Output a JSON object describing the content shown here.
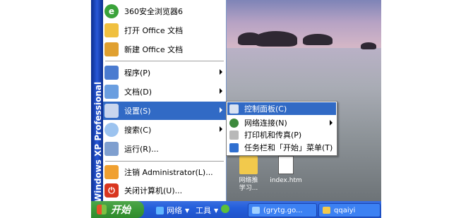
{
  "start_menu": {
    "sidebar_text": "Windows XP Professional",
    "pinned": [
      {
        "label": "360安全浏览器6",
        "icon": "browser-360-icon"
      },
      {
        "label": "打开 Office 文档",
        "icon": "open-office-doc-icon"
      },
      {
        "label": "新建 Office 文档",
        "icon": "new-office-doc-icon"
      }
    ],
    "items": [
      {
        "label": "程序(P)",
        "icon": "programs-icon",
        "has_submenu": true
      },
      {
        "label": "文档(D)",
        "icon": "documents-icon",
        "has_submenu": true
      },
      {
        "label": "设置(S)",
        "icon": "settings-icon",
        "has_submenu": true,
        "highlighted": true
      },
      {
        "label": "搜索(C)",
        "icon": "search-icon",
        "has_submenu": true
      },
      {
        "label": "运行(R)...",
        "icon": "run-icon",
        "has_submenu": false
      }
    ],
    "bottom": [
      {
        "label": "注销 Administrator(L)...",
        "icon": "logoff-icon"
      },
      {
        "label": "关闭计算机(U)...",
        "icon": "shutdown-icon"
      }
    ]
  },
  "settings_submenu": {
    "items": [
      {
        "label": "控制面板(C)",
        "icon": "control-panel-icon",
        "highlighted": true
      },
      {
        "label": "网络连接(N)",
        "icon": "network-connections-icon",
        "has_submenu": true
      },
      {
        "label": "打印机和传真(P)",
        "icon": "printers-faxes-icon"
      },
      {
        "label": "任务栏和「开始」菜单(T)",
        "icon": "taskbar-start-menu-icon"
      }
    ]
  },
  "desktop": {
    "icons": [
      {
        "label": "网络推\n学习...",
        "icon": "folder-icon"
      },
      {
        "label": "index.htm",
        "icon": "html-file-icon"
      }
    ]
  },
  "taskbar": {
    "start_label": "开始",
    "toolbar": [
      {
        "label": "网络",
        "icon": "network-icon"
      },
      {
        "label": "工具",
        "icon": "tools-icon"
      }
    ],
    "tasks": [
      {
        "label": "(grytg.go...",
        "icon": "ie-window-icon"
      },
      {
        "label": "qqaiyi",
        "icon": "folder-icon"
      }
    ]
  },
  "colors": {
    "highlight": "#316ac5",
    "taskbar": "#245edb",
    "start_button": "#3a9a37",
    "sidebar": "#1a47b8"
  }
}
